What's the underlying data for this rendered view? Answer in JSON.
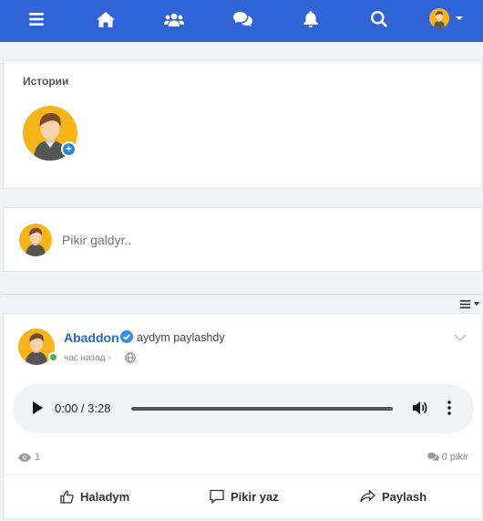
{
  "colors": {
    "nav": "#3064d6",
    "link": "#2d66c9",
    "online": "#4caf50",
    "add": "#2b88d8",
    "avatar_bg": "#f7b519"
  },
  "nav": {
    "icons": [
      "menu-icon",
      "home-icon",
      "friends-icon",
      "messages-icon",
      "bell-icon",
      "search-icon"
    ]
  },
  "stories": {
    "title": "Истории"
  },
  "composer": {
    "placeholder": "Pikir galdyr.."
  },
  "post": {
    "author": "Abaddon",
    "action": "aydym paylashdy",
    "time": "час назад -",
    "audio": {
      "time": "0:00 / 3:28"
    },
    "views": "1",
    "comments": "0 pikir",
    "buttons": {
      "like": "Haladym",
      "comment": "Pikir yaz",
      "share": "Paylash"
    }
  }
}
